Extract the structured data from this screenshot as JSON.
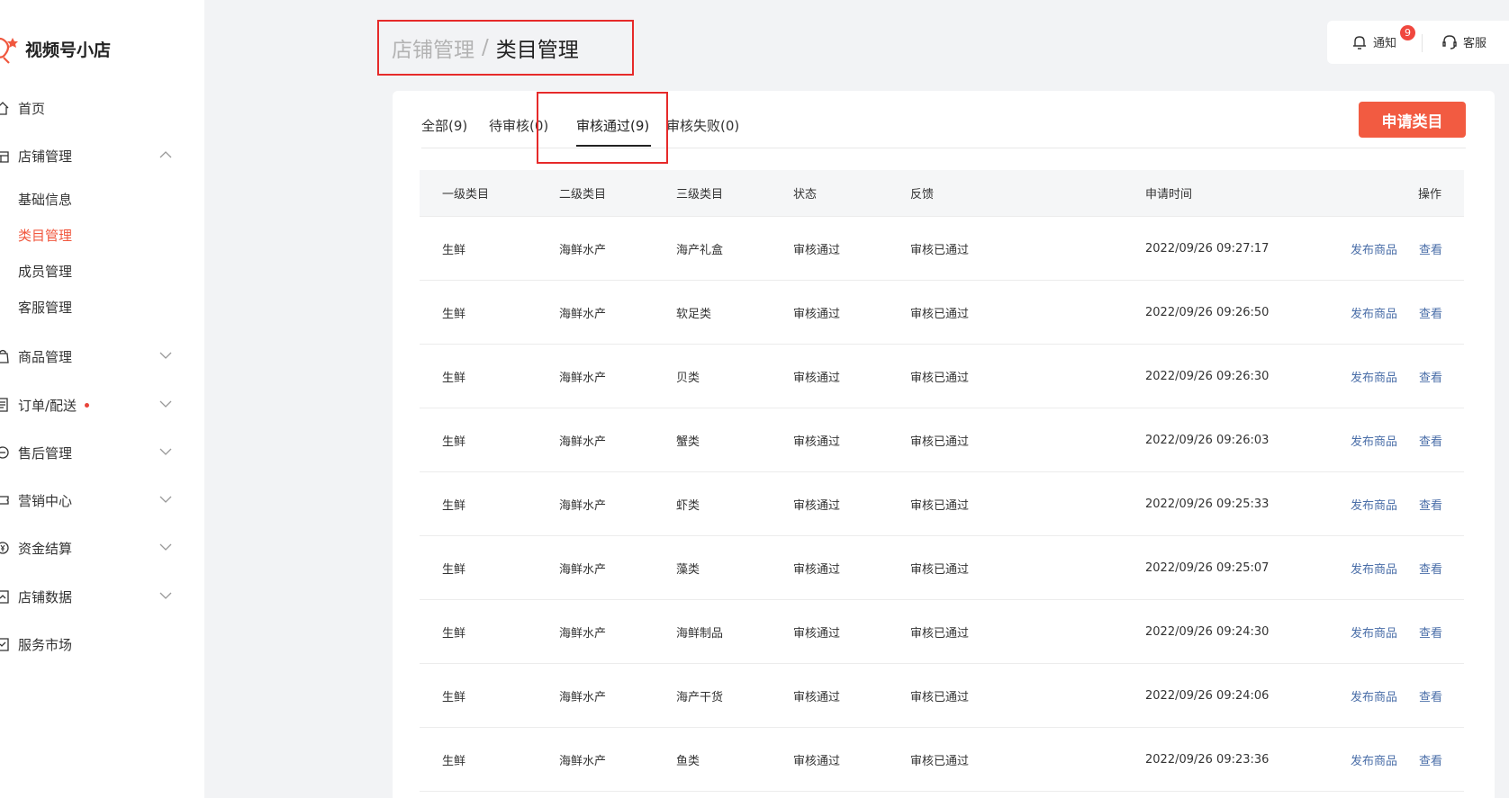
{
  "sidebar": {
    "brand": "视频号小店",
    "nav": {
      "home": "首页",
      "shop": "店铺管理",
      "shop_sub": [
        "基础信息",
        "类目管理",
        "成员管理",
        "客服管理"
      ],
      "goods": "商品管理",
      "orders": "订单/配送",
      "aftersale": "售后管理",
      "marketing": "营销中心",
      "finance": "资金结算",
      "data": "店铺数据",
      "market": "服务市场"
    },
    "active_sub": "类目管理"
  },
  "breadcrumb": {
    "parent": "店铺管理",
    "separator": "/",
    "current": "类目管理"
  },
  "topbar": {
    "notify_label": "通知",
    "notify_count": "9",
    "service_label": "客服"
  },
  "tabs": [
    {
      "label": "全部(9)"
    },
    {
      "label": "待审核(0)"
    },
    {
      "label": "审核通过(9)"
    },
    {
      "label": "审核失败(0)"
    }
  ],
  "active_tab": "审核通过(9)",
  "apply_button": "申请类目",
  "colors": {
    "accent": "#f25b41",
    "link": "#4a6ea8",
    "highlight_box": "#e62a2a"
  },
  "table": {
    "headers": [
      "一级类目",
      "二级类目",
      "三级类目",
      "状态",
      "反馈",
      "申请时间",
      "操作"
    ],
    "rows": [
      {
        "l1": "生鲜",
        "l2": "海鲜水产",
        "l3": "海产礼盒",
        "status": "审核通过",
        "feedback": "审核已通过",
        "time": "2022/09/26 09:27:17",
        "publish": "发布商品",
        "view": "查看"
      },
      {
        "l1": "生鲜",
        "l2": "海鲜水产",
        "l3": "软足类",
        "status": "审核通过",
        "feedback": "审核已通过",
        "time": "2022/09/26 09:26:50",
        "publish": "发布商品",
        "view": "查看"
      },
      {
        "l1": "生鲜",
        "l2": "海鲜水产",
        "l3": "贝类",
        "status": "审核通过",
        "feedback": "审核已通过",
        "time": "2022/09/26 09:26:30",
        "publish": "发布商品",
        "view": "查看"
      },
      {
        "l1": "生鲜",
        "l2": "海鲜水产",
        "l3": "蟹类",
        "status": "审核通过",
        "feedback": "审核已通过",
        "time": "2022/09/26 09:26:03",
        "publish": "发布商品",
        "view": "查看"
      },
      {
        "l1": "生鲜",
        "l2": "海鲜水产",
        "l3": "虾类",
        "status": "审核通过",
        "feedback": "审核已通过",
        "time": "2022/09/26 09:25:33",
        "publish": "发布商品",
        "view": "查看"
      },
      {
        "l1": "生鲜",
        "l2": "海鲜水产",
        "l3": "藻类",
        "status": "审核通过",
        "feedback": "审核已通过",
        "time": "2022/09/26 09:25:07",
        "publish": "发布商品",
        "view": "查看"
      },
      {
        "l1": "生鲜",
        "l2": "海鲜水产",
        "l3": "海鲜制品",
        "status": "审核通过",
        "feedback": "审核已通过",
        "time": "2022/09/26 09:24:30",
        "publish": "发布商品",
        "view": "查看"
      },
      {
        "l1": "生鲜",
        "l2": "海鲜水产",
        "l3": "海产干货",
        "status": "审核通过",
        "feedback": "审核已通过",
        "time": "2022/09/26 09:24:06",
        "publish": "发布商品",
        "view": "查看"
      },
      {
        "l1": "生鲜",
        "l2": "海鲜水产",
        "l3": "鱼类",
        "status": "审核通过",
        "feedback": "审核已通过",
        "time": "2022/09/26 09:23:36",
        "publish": "发布商品",
        "view": "查看"
      }
    ]
  }
}
